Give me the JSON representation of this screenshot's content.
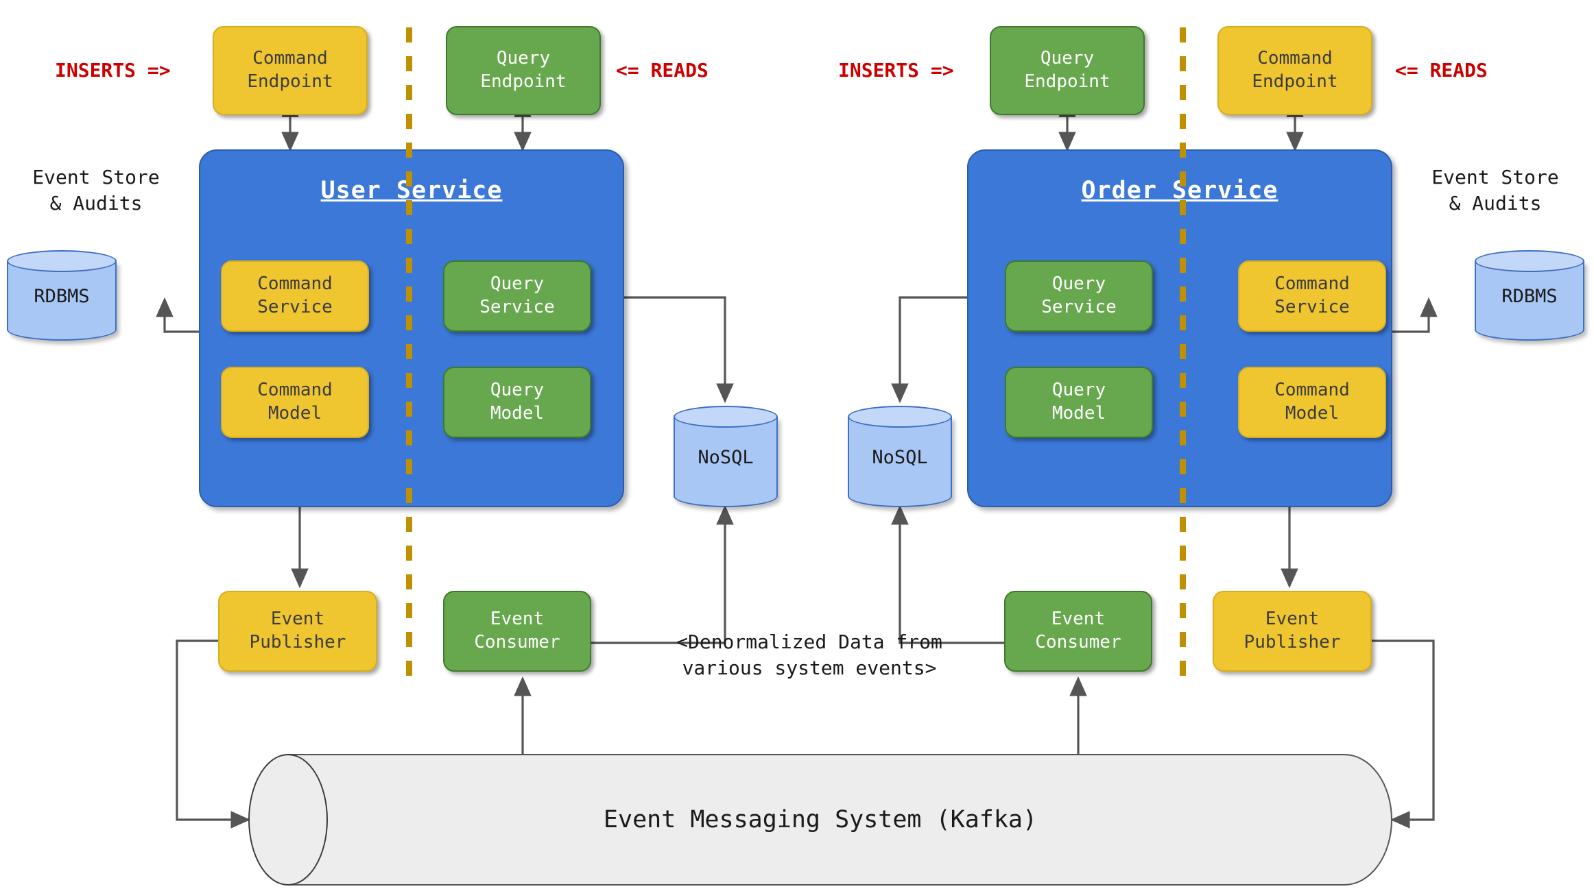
{
  "diagram": {
    "title": "CQRS with Event Sourcing across User and Order microservices",
    "colors": {
      "service_panel": "#3c78d8",
      "command_box": "#efc530",
      "query_box": "#67a84e",
      "database": "#a9c7f4",
      "divider": "#bf9000",
      "annotation_red": "#cc0000",
      "kafka": "#ededed"
    }
  },
  "left": {
    "service_title": "User Service",
    "inserts_label": "INSERTS =>",
    "reads_label": "<= READS",
    "command_endpoint": "Command\nEndpoint",
    "query_endpoint": "Query\nEndpoint",
    "command_service": "Command\nService",
    "command_model": "Command\nModel",
    "query_service": "Query\nService",
    "query_model": "Query\nModel",
    "event_store_label": "Event Store\n& Audits",
    "rdbms": "RDBMS",
    "nosql": "NoSQL",
    "event_publisher": "Event\nPublisher",
    "event_consumer": "Event\nConsumer"
  },
  "right": {
    "service_title": "Order Service",
    "inserts_label": "INSERTS =>",
    "reads_label": "<= READS",
    "command_endpoint": "Command\nEndpoint",
    "query_endpoint": "Query\nEndpoint",
    "command_service": "Command\nService",
    "command_model": "Command\nModel",
    "query_service": "Query\nService",
    "query_model": "Query\nModel",
    "event_store_label": "Event Store\n& Audits",
    "rdbms": "RDBMS",
    "nosql": "NoSQL",
    "event_publisher": "Event\nPublisher",
    "event_consumer": "Event\nConsumer"
  },
  "center": {
    "denormalized_note": "<Denormalized Data from\nvarious system events>",
    "kafka_label": "Event Messaging System (Kafka)"
  }
}
